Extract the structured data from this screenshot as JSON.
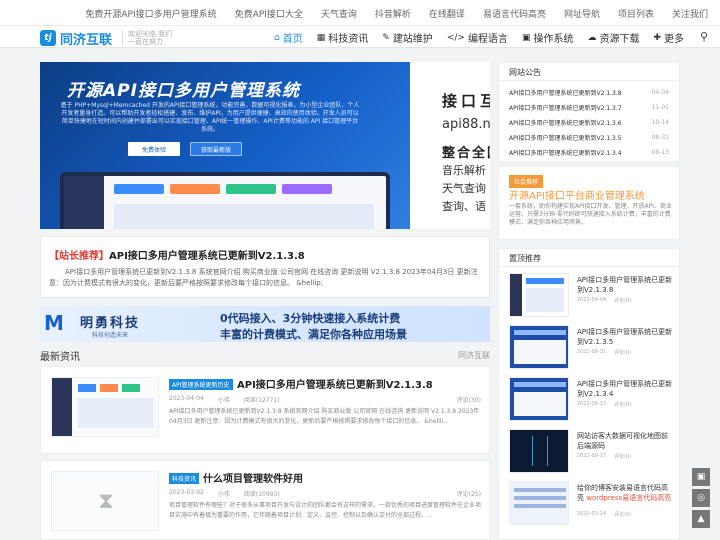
{
  "topbar": {
    "links": [
      "免费开源API接口多用户管理系统",
      "免费API接口大全",
      "天气查询",
      "抖音解析",
      "在线翻译",
      "易语言代码高亮",
      "网址导航",
      "项目列表",
      "关注我们"
    ]
  },
  "logo": {
    "mark": "tj",
    "text": "同济互联",
    "slogan": "欢迎光临 我们一直在努力"
  },
  "nav": {
    "items": [
      {
        "icon": "⌂",
        "label": "首页"
      },
      {
        "icon": "▦",
        "label": "科技资讯"
      },
      {
        "icon": "✎",
        "label": "建站维护"
      },
      {
        "icon": "</>",
        "label": "编程语言"
      },
      {
        "icon": "▣",
        "label": "操作系统"
      },
      {
        "icon": "☁",
        "label": "资源下载"
      },
      {
        "icon": "✚",
        "label": "更多"
      }
    ],
    "search_icon": "⚲"
  },
  "hero": {
    "title": "开源API接口多用户管理系统",
    "desc": "基于 PHP+Mysql+Memcached 开发的API接口管理系统，功能完善，数据可视化报表，为小型企业团队、个人开发者量身打造。可以帮助开发者轻松搭建、发布、维护API，为用户提供便捷、高效的使用体验。开发人员可以简单快捷地在短时间内创建并部署出可以实现接口管理、API统一管理操作、API计费等功能的 API 接口管理平台系统。",
    "btn1": "免费体验",
    "btn2": "获取最新版"
  },
  "hero_right": {
    "title": "接口互",
    "url": "api88.ne",
    "sub": "整合全国",
    "lines": [
      "音乐解析",
      "天气查询",
      "查询、语"
    ]
  },
  "recommend": {
    "tag": "【站长推荐】",
    "title": "API接口多用户管理系统已更新到V2.1.3.8",
    "body": "API接口多用户管理系统已更新到V2.1.3.8 系统官网介绍 购买商业版 公司官网 在线咨询 更新说明 V2.1.3.8 2023年04月3日 更新注意：因为计费模式有很大的变化，更新后要严格按照要求修改每个接口的信息。 &hellip;"
  },
  "banner2": {
    "logo": "M",
    "name": "明勇科技",
    "name_sub": "科技创造未来",
    "line1": "0代码接入、3分钟快速接入系统计费",
    "line2": "丰富的计费模式、满足你各种应用场景"
  },
  "latest": {
    "title": "最新资讯",
    "right": "同济互联"
  },
  "cards": [
    {
      "category": "API管理系统更新历史",
      "title": "API接口多用户管理系统已更新到V2.1.3.8",
      "date": "2023-04-04",
      "author": "小伟",
      "views": "阅读(12771)",
      "comments": "评论(30)",
      "desc": "API接口多用户管理系统已更新到V2.1.3.8 系统官网介绍 购买商业版 公司官网 在线咨询 更新说明 V2.1.3.8 2023年04月3日 更新注意：因为计费模式有很大的变化，更新后要严格按照要求修改每个接口的信息。 &hellli..."
    },
    {
      "category": "科技资讯",
      "title": "什么项目管理软件好用",
      "date": "2023-03-02",
      "author": "小伟",
      "views": "阅读(10993)",
      "comments": "评论(25)",
      "desc": "项目管理软件有哪些？对于很多从事项目开发与设计的团队都会有这样的需求，一款优秀的项目进度管理软件在企业项目实施中有着极为重要的作用，它伴随着项目计划、定义、监控、控制以及确认交付的全部过程。..."
    }
  ],
  "notice": {
    "title": "网站公告",
    "items": [
      {
        "text": "API接口多用户管理系统已更新到V2.1.3.8",
        "date": "04-04"
      },
      {
        "text": "API接口多用户管理系统已更新到V2.1.3.7",
        "date": "11-01"
      },
      {
        "text": "API接口多用户管理系统已更新到V2.1.3.6",
        "date": "10-14"
      },
      {
        "text": "API接口多用户管理系统已更新到V2.1.3.5",
        "date": "08-31"
      },
      {
        "text": "API接口多用户管理系统已更新到V2.1.3.4",
        "date": "08-13"
      }
    ]
  },
  "ad": {
    "tag": "社会推荐",
    "title": "开源API接口平台商业管理系统",
    "desc": "一套系统，助你构建实现API接口开发、管理、开放API、商业运营。只需3分钟 零代码即可快速接入系统计费，丰富的计费模式、满足你各种应用场景。"
  },
  "top": {
    "title": "置顶推荐",
    "items": [
      {
        "title": "API接口多用户管理系统已更新到V2.1.3.8",
        "hl": "",
        "date": "2023-04-04",
        "comments": "评论(0)"
      },
      {
        "title": "API接口多用户管理系统已更新到V2.1.3.5",
        "hl": "",
        "date": "2022-08-31",
        "comments": "评论(0)"
      },
      {
        "title": "API接口多用户管理系统已更新到V2.1.3.4",
        "hl": "",
        "date": "2022-08-13",
        "comments": "评论(0)"
      },
      {
        "title": "网站访客大数据可视化地图前后端源码",
        "hl": "",
        "date": "2022-09-17",
        "comments": "评论(0)"
      },
      {
        "title": "给你的博客安装易语言代码高亮 ",
        "hl": "wordpress易语言代码高亮",
        "date": "2020-03-14",
        "comments": "评论(0)"
      }
    ]
  },
  "float": [
    "▣",
    "◎",
    "▲"
  ],
  "colors": {
    "brand": "#1a8ce0",
    "accent": "#f39a3c",
    "tag_red": "#e23b2e"
  }
}
